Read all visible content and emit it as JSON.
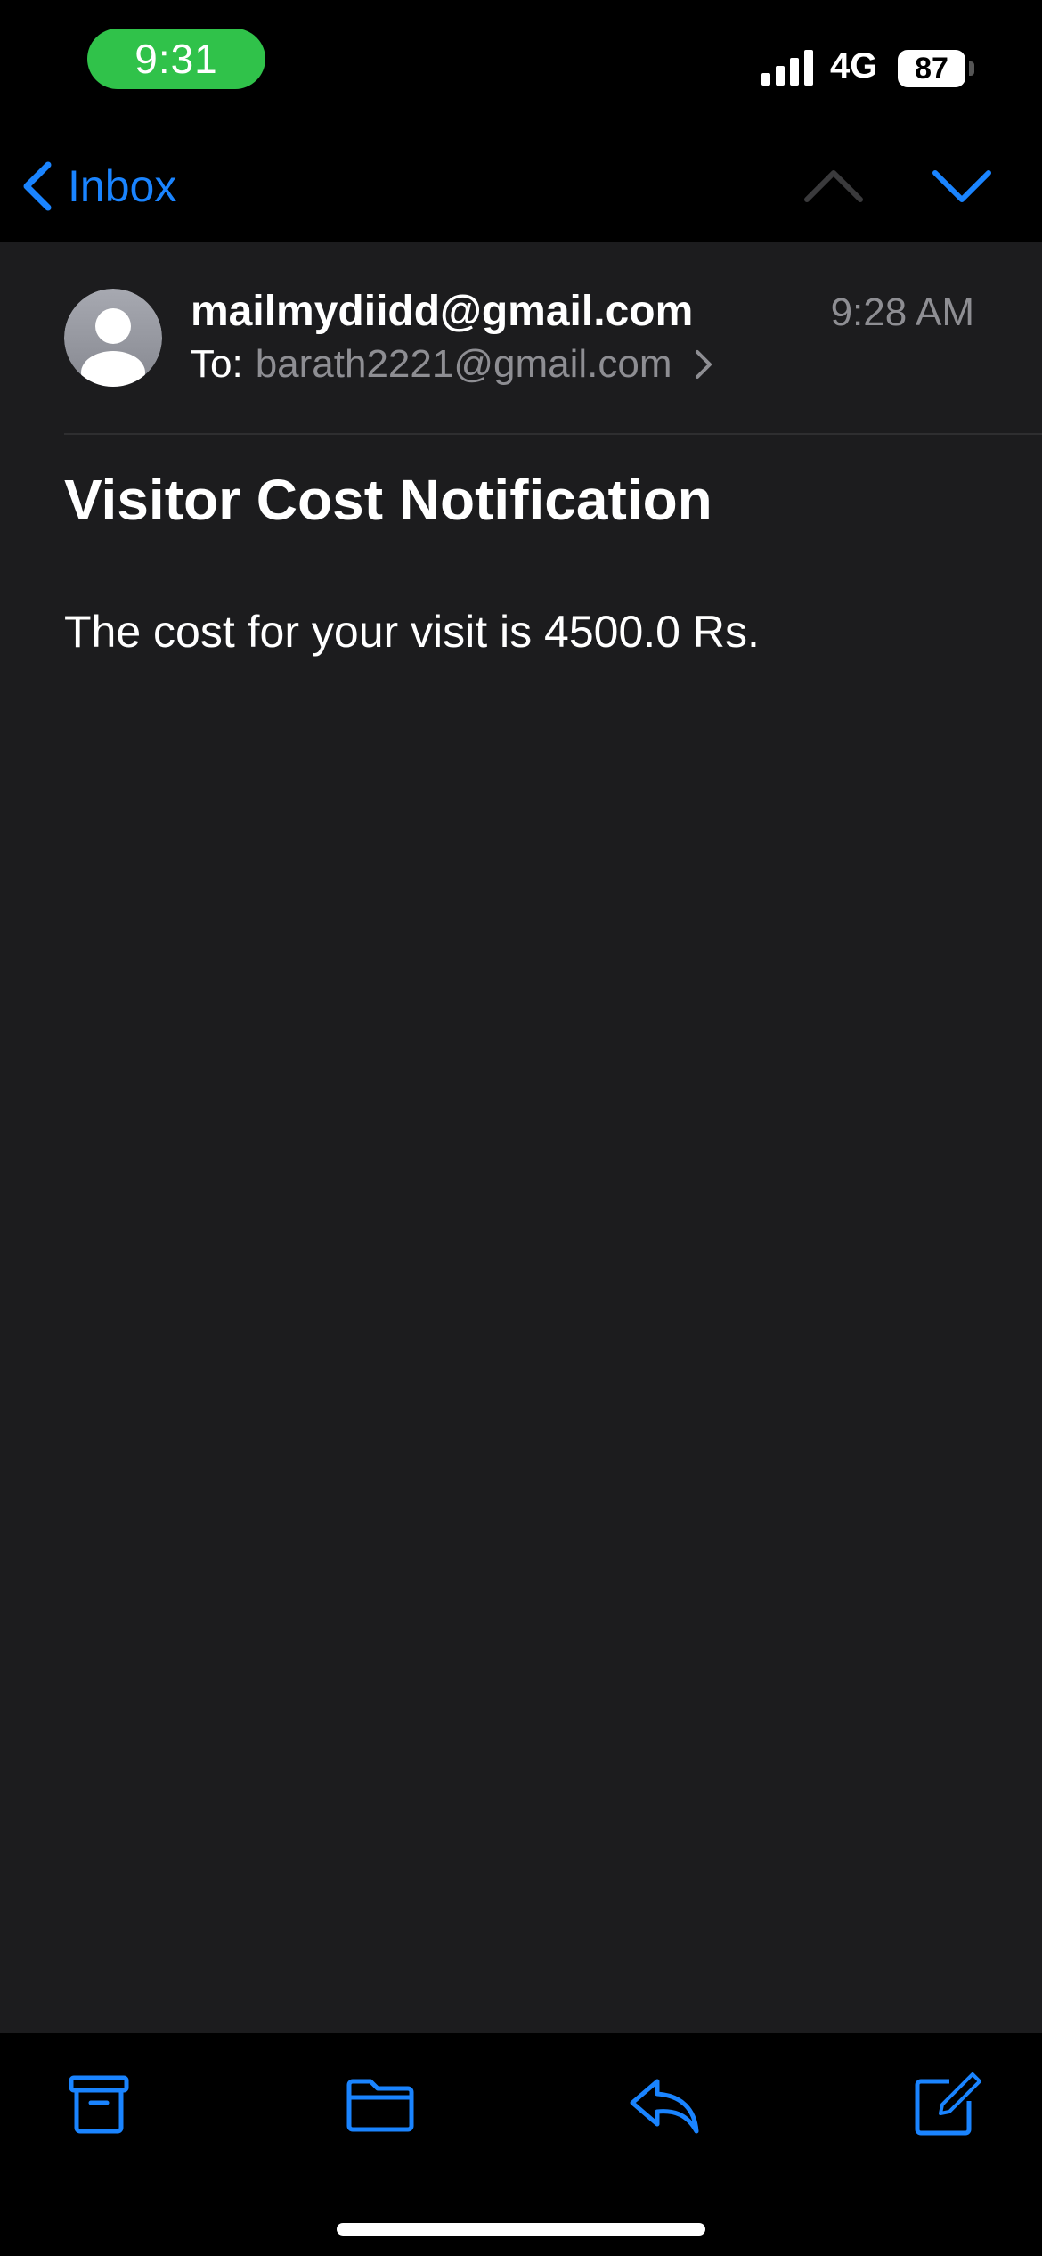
{
  "status_bar": {
    "time": "9:31",
    "network": "4G",
    "battery": "87"
  },
  "nav": {
    "back_label": "Inbox"
  },
  "message": {
    "sender": "mailmydiidd@gmail.com",
    "date": "9:28 AM",
    "to_label": "To:",
    "recipient": "barath2221@gmail.com",
    "subject": "Visitor Cost Notification",
    "body": "The cost for your visit is 4500.0 Rs."
  },
  "colors": {
    "accent": "#1a84ff",
    "time_pill": "#30c24a",
    "background": "#1c1c1e"
  },
  "toolbar": {
    "icons": [
      "archive-icon",
      "folder-icon",
      "reply-icon",
      "compose-icon"
    ]
  }
}
